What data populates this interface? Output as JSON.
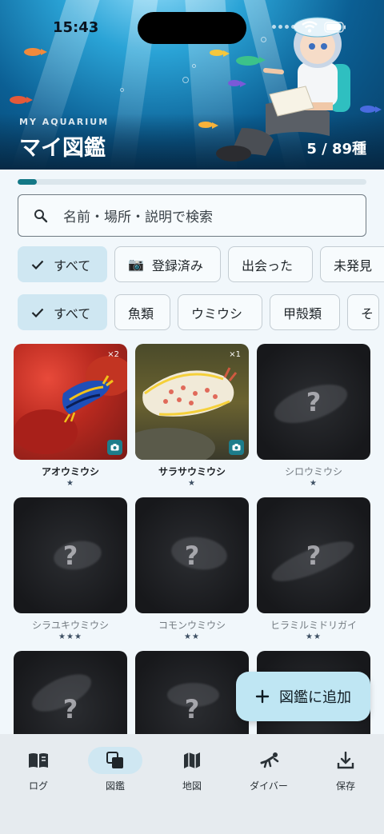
{
  "status": {
    "time": "15:43"
  },
  "header": {
    "label": "MY AQUARIUM",
    "title": "マイ図鑑",
    "count": "5 / 89種"
  },
  "progress": {
    "fraction": 0.056
  },
  "search": {
    "placeholder": "名前・場所・説明で検索"
  },
  "status_filters": [
    {
      "label": "すべて",
      "active": true,
      "icon": "check-icon"
    },
    {
      "label": "登録済み",
      "active": false,
      "icon": "camera-icon"
    },
    {
      "label": "出会った",
      "active": false
    },
    {
      "label": "未発見",
      "active": false
    }
  ],
  "category_filters": [
    {
      "label": "すべて",
      "active": true,
      "icon": "check-icon"
    },
    {
      "label": "魚類",
      "active": false
    },
    {
      "label": "ウミウシ",
      "active": false
    },
    {
      "label": "甲殻類",
      "active": false
    },
    {
      "label": "そ",
      "active": false
    }
  ],
  "species": [
    {
      "name": "アオウミウシ",
      "stars": "★",
      "known": true,
      "count": "×2",
      "photo": "blue-nudibranch"
    },
    {
      "name": "サラサウミウシ",
      "stars": "★",
      "known": true,
      "count": "×1",
      "photo": "white-nudibranch"
    },
    {
      "name": "シロウミウシ",
      "stars": "★",
      "known": false,
      "mark": "?"
    },
    {
      "name": "シラユキウミウシ",
      "stars": "★★★",
      "known": false,
      "mark": "?"
    },
    {
      "name": "コモンウミウシ",
      "stars": "★★",
      "known": false,
      "mark": "?"
    },
    {
      "name": "ヒラミルミドリガイ",
      "stars": "★★",
      "known": false,
      "mark": "?"
    },
    {
      "name": "",
      "stars": "",
      "known": false,
      "mark": "?"
    },
    {
      "name": "",
      "stars": "",
      "known": false,
      "mark": "?"
    },
    {
      "name": "",
      "stars": "",
      "known": false,
      "mark": "?"
    }
  ],
  "fab": {
    "label": "図鑑に追加"
  },
  "nav": [
    {
      "label": "ログ",
      "icon": "book-icon",
      "active": false
    },
    {
      "label": "図鑑",
      "icon": "collection-icon",
      "active": true
    },
    {
      "label": "地図",
      "icon": "map-icon",
      "active": false
    },
    {
      "label": "ダイバー",
      "icon": "diver-icon",
      "active": false
    },
    {
      "label": "保存",
      "icon": "download-icon",
      "active": false
    }
  ]
}
